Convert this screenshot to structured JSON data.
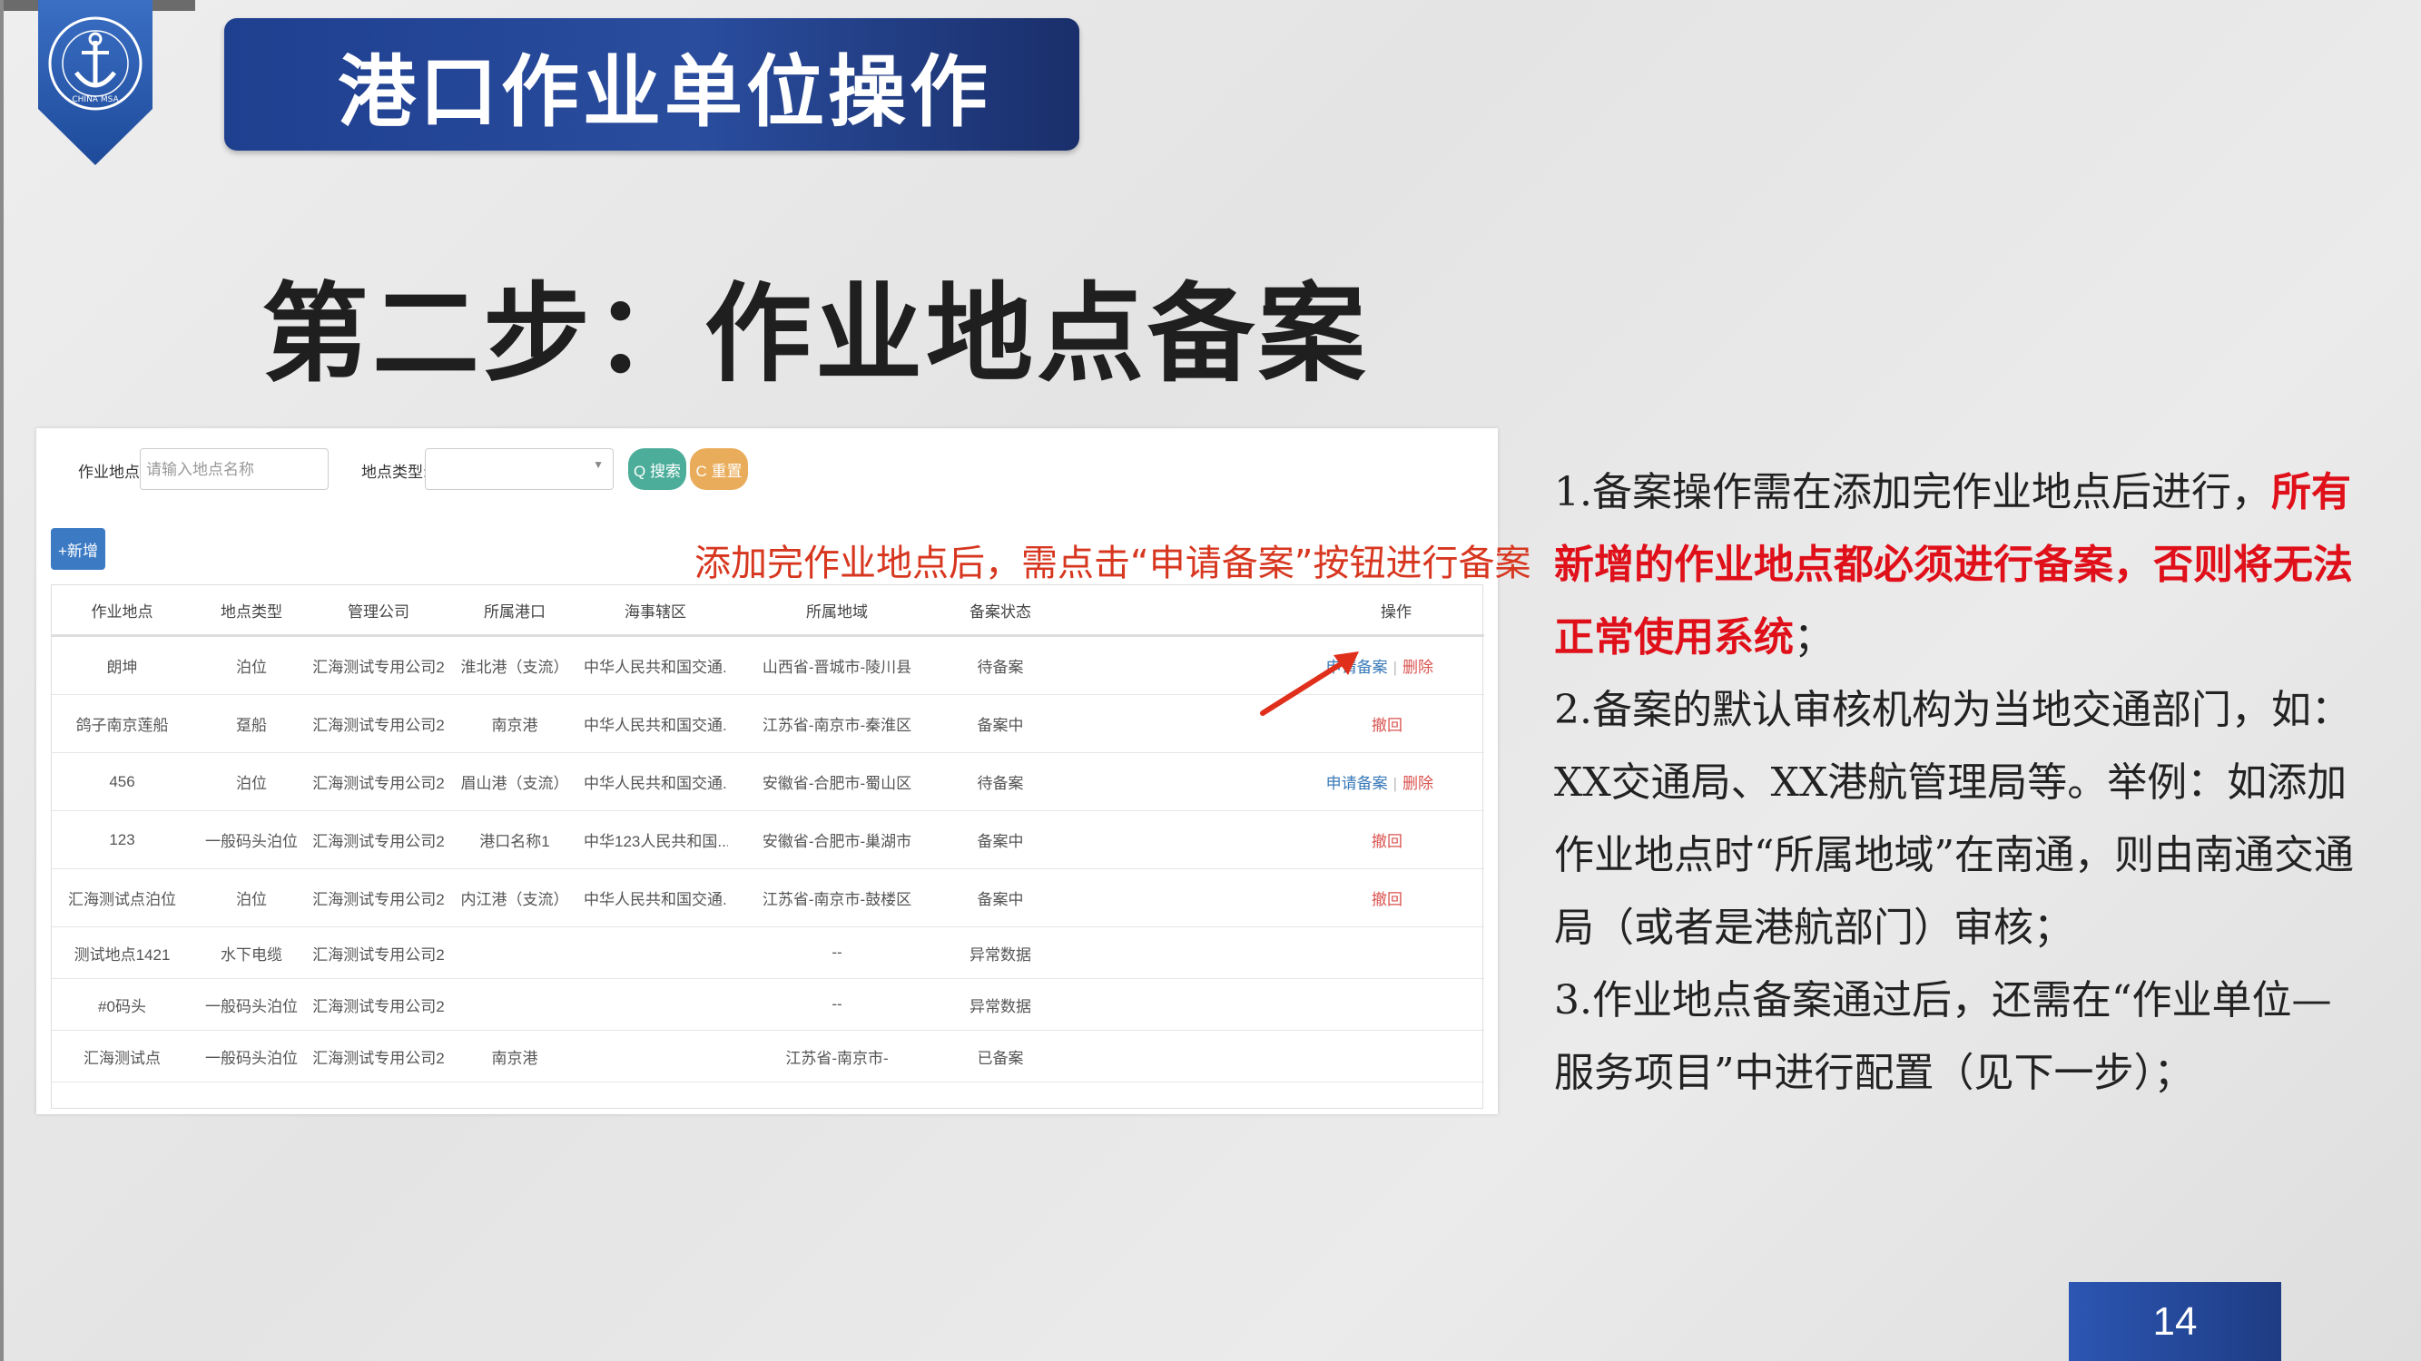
{
  "slide": {
    "banner_title": "港口作业单位操作",
    "step_title": "第二步：作业地点备案",
    "page_number": "14",
    "logo": {
      "icon": "anchor-icon",
      "ring_text": "中国海事局",
      "badge_text": "CHINA MSA",
      "color": "#2a5db0"
    }
  },
  "screenshot": {
    "filter": {
      "site_label": "作业地点:",
      "site_placeholder": "请输入地点名称",
      "type_label": "地点类型:",
      "search_label": "Q 搜索",
      "reset_label": "C 重置"
    },
    "add_button": "+新增",
    "annotation": "添加完作业地点后，需点击“申请备案”按钮进行备案",
    "table": {
      "headers": [
        "作业地点",
        "地点类型",
        "管理公司",
        "所属港口",
        "海事辖区",
        "所属地域",
        "备案状态",
        "操作"
      ],
      "rows": [
        [
          "朗坤",
          "泊位",
          "汇海测试专用公司2",
          "淮北港（支流）",
          "中华人民共和国交通...",
          "山西省-晋城市-陵川县",
          "待备案"
        ],
        [
          "鸽子南京莲船",
          "趸船",
          "汇海测试专用公司2",
          "南京港",
          "中华人民共和国交通...",
          "江苏省-南京市-秦淮区",
          "备案中"
        ],
        [
          "456",
          "泊位",
          "汇海测试专用公司2",
          "眉山港（支流）",
          "中华人民共和国交通...",
          "安徽省-合肥市-蜀山区",
          "待备案"
        ],
        [
          "123",
          "一般码头泊位",
          "汇海测试专用公司2",
          "港口名称1",
          "中华123人民共和国...",
          "安徽省-合肥市-巢湖市",
          "备案中"
        ],
        [
          "汇海测试点泊位",
          "泊位",
          "汇海测试专用公司2",
          "内江港（支流）",
          "中华人民共和国交通...",
          "江苏省-南京市-鼓楼区",
          "备案中"
        ],
        [
          "测试地点1421",
          "水下电缆",
          "汇海测试专用公司2",
          "",
          "",
          "--",
          "异常数据"
        ],
        [
          "#0码头",
          "一般码头泊位",
          "汇海测试专用公司2",
          "",
          "",
          "--",
          "异常数据"
        ],
        [
          "汇海测试点",
          "一般码头泊位",
          "汇海测试专用公司2",
          "南京港",
          "",
          "江苏省-南京市-",
          "已备案"
        ]
      ],
      "actions": {
        "apply": "申请备案",
        "delete": "删除",
        "withdraw": "撤回"
      }
    }
  },
  "description": {
    "p1_normal": "1.备案操作需在添加完作业地点后进行，",
    "p1_red": "所有新增的作业地点都必须进行备案，否则将无法正常使用系统",
    "p1_end": "；",
    "p2": "2.备案的默认审核机构为当地交通部门，如：XX交通局、XX港航管理局等。举例：如添加作业地点时“所属地域”在南通，则由南通交通局（或者是港航部门）审核；",
    "p3": "3.作业地点备案通过后，还需在“作业单位—服务项目”中进行配置（见下一步）；"
  },
  "colors": {
    "banner": "#2a4d9e",
    "search_button": "#4cae9a",
    "reset_button": "#e9ac5a",
    "add_button": "#3c7bc4",
    "annotation": "#d7361f",
    "highlight": "#e0101a"
  }
}
